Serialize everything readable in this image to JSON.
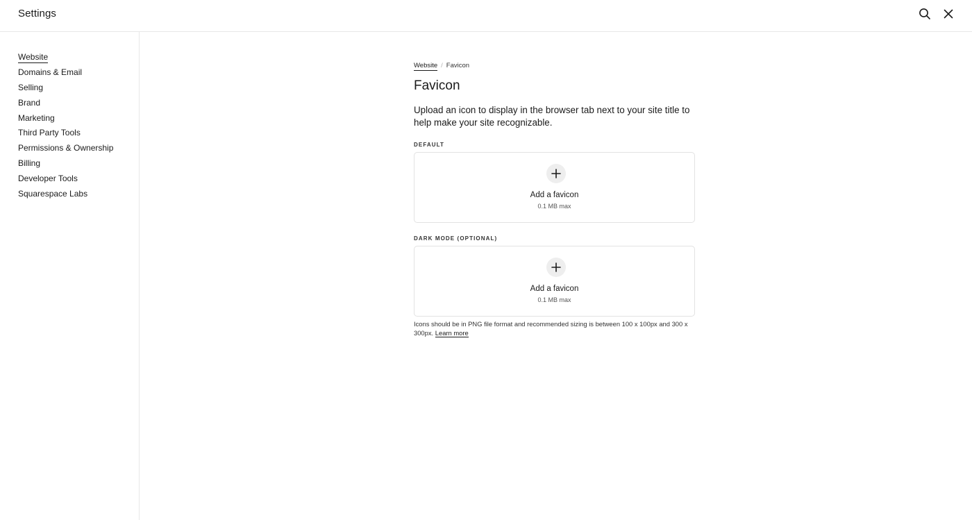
{
  "app": {
    "title": "Settings"
  },
  "header": {
    "search_icon": "search-icon",
    "close_icon": "close-icon"
  },
  "sidebar": {
    "items": [
      {
        "label": "Website",
        "active": true
      },
      {
        "label": "Domains & Email"
      },
      {
        "label": "Selling"
      },
      {
        "label": "Brand"
      },
      {
        "label": "Marketing"
      },
      {
        "label": "Third Party Tools"
      },
      {
        "label": "Permissions & Ownership"
      },
      {
        "label": "Billing"
      },
      {
        "label": "Developer Tools"
      },
      {
        "label": "Squarespace Labs"
      }
    ]
  },
  "breadcrumb": {
    "parent": "Website",
    "separator": "/",
    "current": "Favicon"
  },
  "page": {
    "title": "Favicon",
    "description": "Upload an icon to display in the browser tab next to your site title to help make your site recognizable."
  },
  "uploads": [
    {
      "label": "Default",
      "title": "Add a favicon",
      "size": "0.1 MB max"
    },
    {
      "label": "Dark Mode (Optional)",
      "title": "Add a favicon",
      "size": "0.1 MB max"
    }
  ],
  "help": {
    "text": "Icons should be in PNG file format and recommended sizing is between 100 x 100px and 300 x 300px.",
    "link": "Learn more"
  }
}
